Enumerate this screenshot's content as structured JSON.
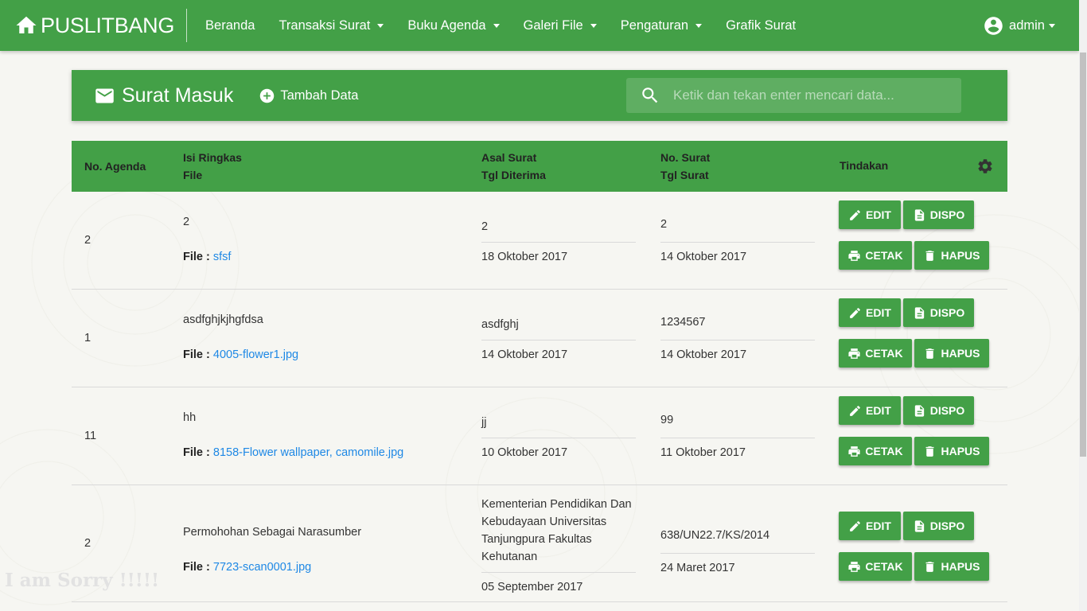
{
  "navbar": {
    "brand": "PUSLITBANG",
    "items": [
      {
        "label": "Beranda",
        "dropdown": false
      },
      {
        "label": "Transaksi Surat",
        "dropdown": true
      },
      {
        "label": "Buku Agenda",
        "dropdown": true
      },
      {
        "label": "Galeri File",
        "dropdown": true
      },
      {
        "label": "Pengaturan",
        "dropdown": true
      },
      {
        "label": "Grafik Surat",
        "dropdown": false
      }
    ],
    "user": "admin"
  },
  "header": {
    "title": "Surat Masuk",
    "add_label": "Tambah Data",
    "search_placeholder": "Ketik dan tekan enter mencari data..."
  },
  "table": {
    "headers": {
      "no_agenda": "No. Agenda",
      "isi_ringkas": "Isi Ringkas",
      "file": "File",
      "asal_surat": "Asal Surat",
      "tgl_diterima": "Tgl Diterima",
      "no_surat": "No. Surat",
      "tgl_surat": "Tgl Surat",
      "tindakan": "Tindakan"
    },
    "file_prefix": "File : ",
    "buttons": {
      "edit": "EDIT",
      "dispo": "DISPO",
      "cetak": "CETAK",
      "hapus": "HAPUS"
    },
    "rows": [
      {
        "no_agenda": "2",
        "isi": "2",
        "file": "sfsf",
        "asal": [
          "2"
        ],
        "tgl_diterima": "18 Oktober 2017",
        "no_surat": "2",
        "tgl_surat": "14 Oktober 2017"
      },
      {
        "no_agenda": "1",
        "isi": "asdfghjkjhgfdsa",
        "file": "4005-flower1.jpg",
        "asal": [
          "asdfghj"
        ],
        "tgl_diterima": "14 Oktober 2017",
        "no_surat": "1234567",
        "tgl_surat": "14 Oktober 2017"
      },
      {
        "no_agenda": "11",
        "isi": "hh",
        "file": "8158-Flower wallpaper, camomile.jpg",
        "asal": [
          "jj"
        ],
        "tgl_diterima": "10 Oktober 2017",
        "no_surat": "99",
        "tgl_surat": "11 Oktober 2017"
      },
      {
        "no_agenda": "2",
        "isi": "Permohohan Sebagai Narasumber",
        "file": "7723-scan0001.jpg",
        "asal": [
          "Kementerian Pendidikan Dan",
          "Kebudayaan Universitas",
          "Tanjungpura Fakultas",
          "Kehutanan"
        ],
        "tgl_diterima": "05 September 2017",
        "no_surat": "638/UN22.7/KS/2014",
        "tgl_surat": "24 Maret 2017"
      }
    ]
  },
  "watermark": "I am Sorry !!!!!",
  "colors": {
    "primary": "#43a047",
    "link": "#1e88e5"
  }
}
